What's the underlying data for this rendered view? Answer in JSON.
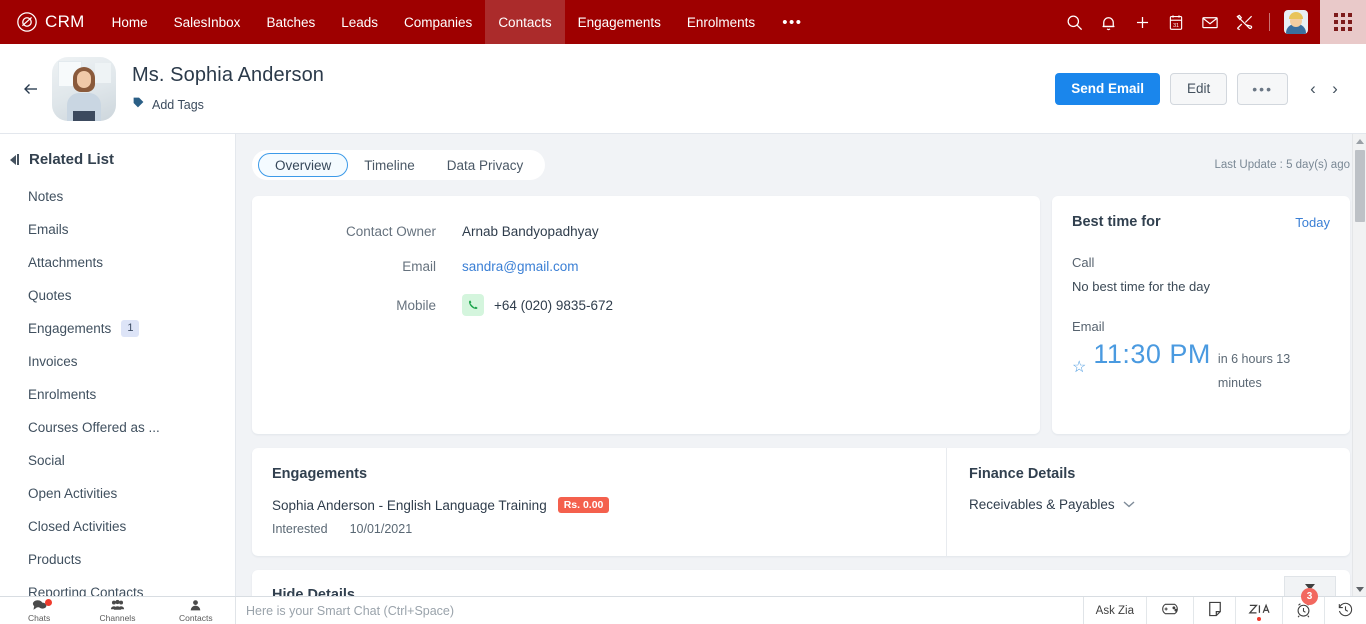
{
  "topnav": {
    "brand": "CRM",
    "items": [
      {
        "label": "Home",
        "active": false
      },
      {
        "label": "SalesInbox",
        "active": false
      },
      {
        "label": "Batches",
        "active": false
      },
      {
        "label": "Leads",
        "active": false
      },
      {
        "label": "Companies",
        "active": false
      },
      {
        "label": "Contacts",
        "active": true
      },
      {
        "label": "Engagements",
        "active": false
      },
      {
        "label": "Enrolments",
        "active": false
      }
    ],
    "more": "•••",
    "icons": [
      "search-icon",
      "bell-icon",
      "plus-icon",
      "calendar-icon",
      "envelope-icon",
      "tools-icon"
    ],
    "calendar_day": "31"
  },
  "record": {
    "name": "Ms. Sophia Anderson",
    "add_tags": "Add Tags",
    "send_email": "Send Email",
    "edit": "Edit",
    "more": "•••",
    "prev": "‹",
    "next": "›"
  },
  "sidebar": {
    "title": "Related List",
    "items": [
      {
        "label": "Notes",
        "badge": ""
      },
      {
        "label": "Emails",
        "badge": ""
      },
      {
        "label": "Attachments",
        "badge": ""
      },
      {
        "label": "Quotes",
        "badge": ""
      },
      {
        "label": "Engagements",
        "badge": "1"
      },
      {
        "label": "Invoices",
        "badge": ""
      },
      {
        "label": "Enrolments",
        "badge": ""
      },
      {
        "label": "Courses Offered as ...",
        "badge": ""
      },
      {
        "label": "Social",
        "badge": ""
      },
      {
        "label": "Open Activities",
        "badge": ""
      },
      {
        "label": "Closed Activities",
        "badge": ""
      },
      {
        "label": "Products",
        "badge": ""
      },
      {
        "label": "Reporting Contacts",
        "badge": ""
      }
    ]
  },
  "main": {
    "tabs": [
      {
        "label": "Overview",
        "active": true
      },
      {
        "label": "Timeline",
        "active": false
      },
      {
        "label": "Data Privacy",
        "active": false
      }
    ],
    "last_update": "Last Update : 5 day(s) ago",
    "details": [
      {
        "label": "Contact Owner",
        "value": "Arnab Bandyopadhyay",
        "type": "text"
      },
      {
        "label": "Email",
        "value": "sandra@gmail.com",
        "type": "link"
      },
      {
        "label": "Mobile",
        "value": "+64 (020) 9835-672",
        "type": "phone"
      }
    ],
    "best_time": {
      "title": "Best time for",
      "today": "Today",
      "call_label": "Call",
      "call_value": "No best time for the day",
      "email_label": "Email",
      "email_time": "11:30 PM",
      "email_in": "in 6 hours 13 minutes"
    },
    "engagements": {
      "title": "Engagements",
      "name": "Sophia Anderson - English Language Training",
      "amount": "Rs. 0.00",
      "status": "Interested",
      "date": "10/01/2021"
    },
    "finance": {
      "title": "Finance Details",
      "item": "Receivables & Payables"
    },
    "hide_details": "Hide Details"
  },
  "bottombar": {
    "tabs": [
      {
        "label": "Chats",
        "icon": "chat-bubbles-icon",
        "dot": true
      },
      {
        "label": "Channels",
        "icon": "people-icon",
        "dot": false
      },
      {
        "label": "Contacts",
        "icon": "person-icon",
        "dot": false
      }
    ],
    "chat_placeholder": "Here is your Smart Chat (Ctrl+Space)",
    "ask_zia": "Ask Zia",
    "alarm_badge": "3"
  },
  "colors": {
    "brand_red": "#9e0000",
    "active_tab_red": "#ab2b2b",
    "primary_blue": "#1a86ec",
    "link_blue": "#3a7fd5",
    "money_red": "#f4604d",
    "badge_red": "#f2685f"
  }
}
